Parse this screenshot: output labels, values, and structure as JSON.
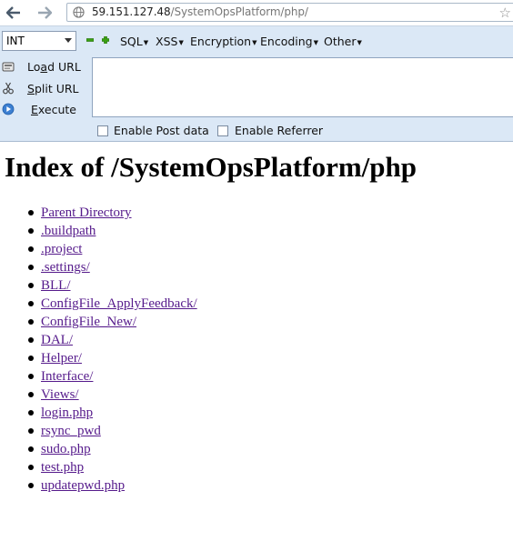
{
  "browser": {
    "url_host": "59.151.127.48",
    "url_path": "/SystemOpsPlatform/php/"
  },
  "hackbar": {
    "select_value": "INT",
    "menus": [
      "SQL",
      "XSS",
      "Encryption",
      "Encoding",
      "Other"
    ],
    "load_url_label": "Load URL",
    "split_url_label": "Split URL",
    "execute_label": "Execute",
    "post_data_label": "Enable Post data",
    "referrer_label": "Enable Referrer",
    "post_data_checked": false,
    "referrer_checked": false
  },
  "page": {
    "title": "Index of /SystemOpsPlatform/php",
    "entries": [
      "Parent Directory",
      ".buildpath",
      ".project",
      ".settings/",
      "BLL/",
      "ConfigFile_ApplyFeedback/",
      "ConfigFile_New/",
      "DAL/",
      "Helper/",
      "Interface/",
      "Views/",
      "login.php",
      "rsync_pwd",
      "sudo.php",
      "test.php",
      "updatepwd.php"
    ]
  }
}
